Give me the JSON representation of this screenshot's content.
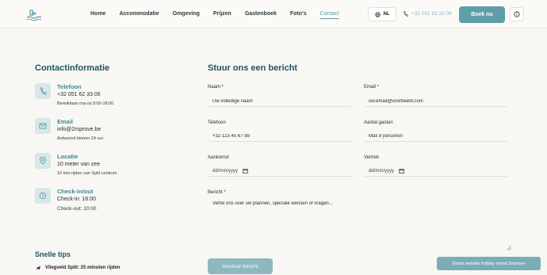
{
  "header": {
    "nav": [
      "Home",
      "Accommodatie",
      "Omgeving",
      "Prijzen",
      "Gastenboek",
      "Foto's",
      "Contact"
    ],
    "active_nav": "Contact",
    "lang": "NL",
    "phone": "+32 051 62 33 06",
    "book_label": "Boek nu"
  },
  "contact": {
    "title": "Contactinformatie",
    "items": [
      {
        "label": "Telefoon",
        "line1": "+32 051 62 33 06",
        "line2": "Bereikbaar ma-za 9:00-18:00",
        "icon": "phone-icon"
      },
      {
        "label": "Email",
        "line1": "info@2mprove.be",
        "line2": "Antwoord binnen 24 uur",
        "icon": "mail-icon"
      },
      {
        "label": "Locatie",
        "line1": "10 meter van zee",
        "line2": "10 min rijden van Split centrum",
        "icon": "map-pin-icon"
      },
      {
        "label": "Check-in/out",
        "line1": "Check-in: 16:00",
        "line2": "Check-out: 10:00",
        "icon": "clock-icon"
      }
    ]
  },
  "tips": {
    "title": "Snelle tips",
    "first": "Vliegveld Split: 25 minuten rijden"
  },
  "form": {
    "title": "Stuur ons een bericht",
    "name_label": "Naam *",
    "name_placeholder": "Uw volledige naam",
    "email_label": "Email *",
    "email_placeholder": "uw.email@voorbeeld.com",
    "phone_label": "Telefoon",
    "phone_placeholder": "+32 123 45 67 89",
    "guests_label": "Aantal gasten",
    "guests_placeholder": "Max 8 personen",
    "arrival_label": "Aankomst",
    "arrival_value": "dd/mm/yyyy",
    "departure_label": "Vertrek",
    "departure_value": "dd/mm/yyyy",
    "message_label": "Bericht *",
    "message_placeholder": "Vertel ons over uw plannen, speciale wensen of vragen...",
    "submit_label": "Verstuur bericht"
  },
  "demo_badge": "Demo website holiday rental 2mprove",
  "colors": {
    "accent": "#5f9ea8",
    "title": "#1f5360",
    "background": "#f9f7f3"
  }
}
